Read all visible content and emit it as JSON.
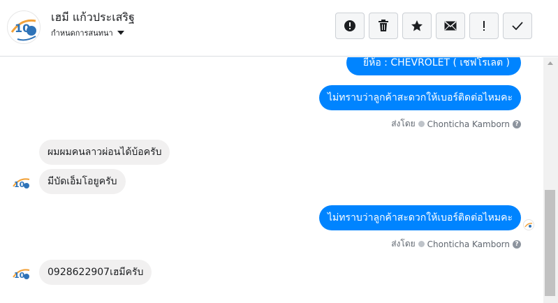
{
  "header": {
    "contact_name": "เฮมี แก้วประเสริฐ",
    "conversation_label": "กำหนดการสนทนา",
    "toolbar": [
      {
        "name": "report-button",
        "icon": "exclamation-circle-icon",
        "label": "Report"
      },
      {
        "name": "delete-button",
        "icon": "trash-icon",
        "label": "Delete"
      },
      {
        "name": "star-button",
        "icon": "star-icon",
        "label": "Star"
      },
      {
        "name": "mark-unread-button",
        "icon": "envelope-icon",
        "label": "Mark as unread"
      },
      {
        "name": "spam-button",
        "icon": "exclamation-icon",
        "label": "Mark as spam"
      },
      {
        "name": "done-button",
        "icon": "check-icon",
        "label": "Done"
      }
    ]
  },
  "messages": {
    "out_1": "ยี่ห้อ : CHEVROLET ( เชฟโรเลต )",
    "out_2": "ไม่ทราบว่าลูกค้าสะดวกให้เบอร์ติดต่อไหมคะ",
    "sent_by_1": {
      "prefix": "ส่งโดย",
      "agent": "Chonticha Kamborn"
    },
    "in_1": "ผมผมคนลาวผ่อนได้บ้อครับ",
    "in_2": "มีบัดเอ็มโอยูครับ",
    "out_3": "ไม่ทราบว่าลูกค้าสะดวกให้เบอร์ติดต่อไหมคะ",
    "sent_by_2": {
      "prefix": "ส่งโดย",
      "agent": "Chonticha Kamborn"
    },
    "in_3": "0928622907เฮมีครับ"
  },
  "colors": {
    "outgoing_bubble": "#0084ff",
    "incoming_bubble": "#f1f0f0",
    "meta_text": "#606770"
  }
}
